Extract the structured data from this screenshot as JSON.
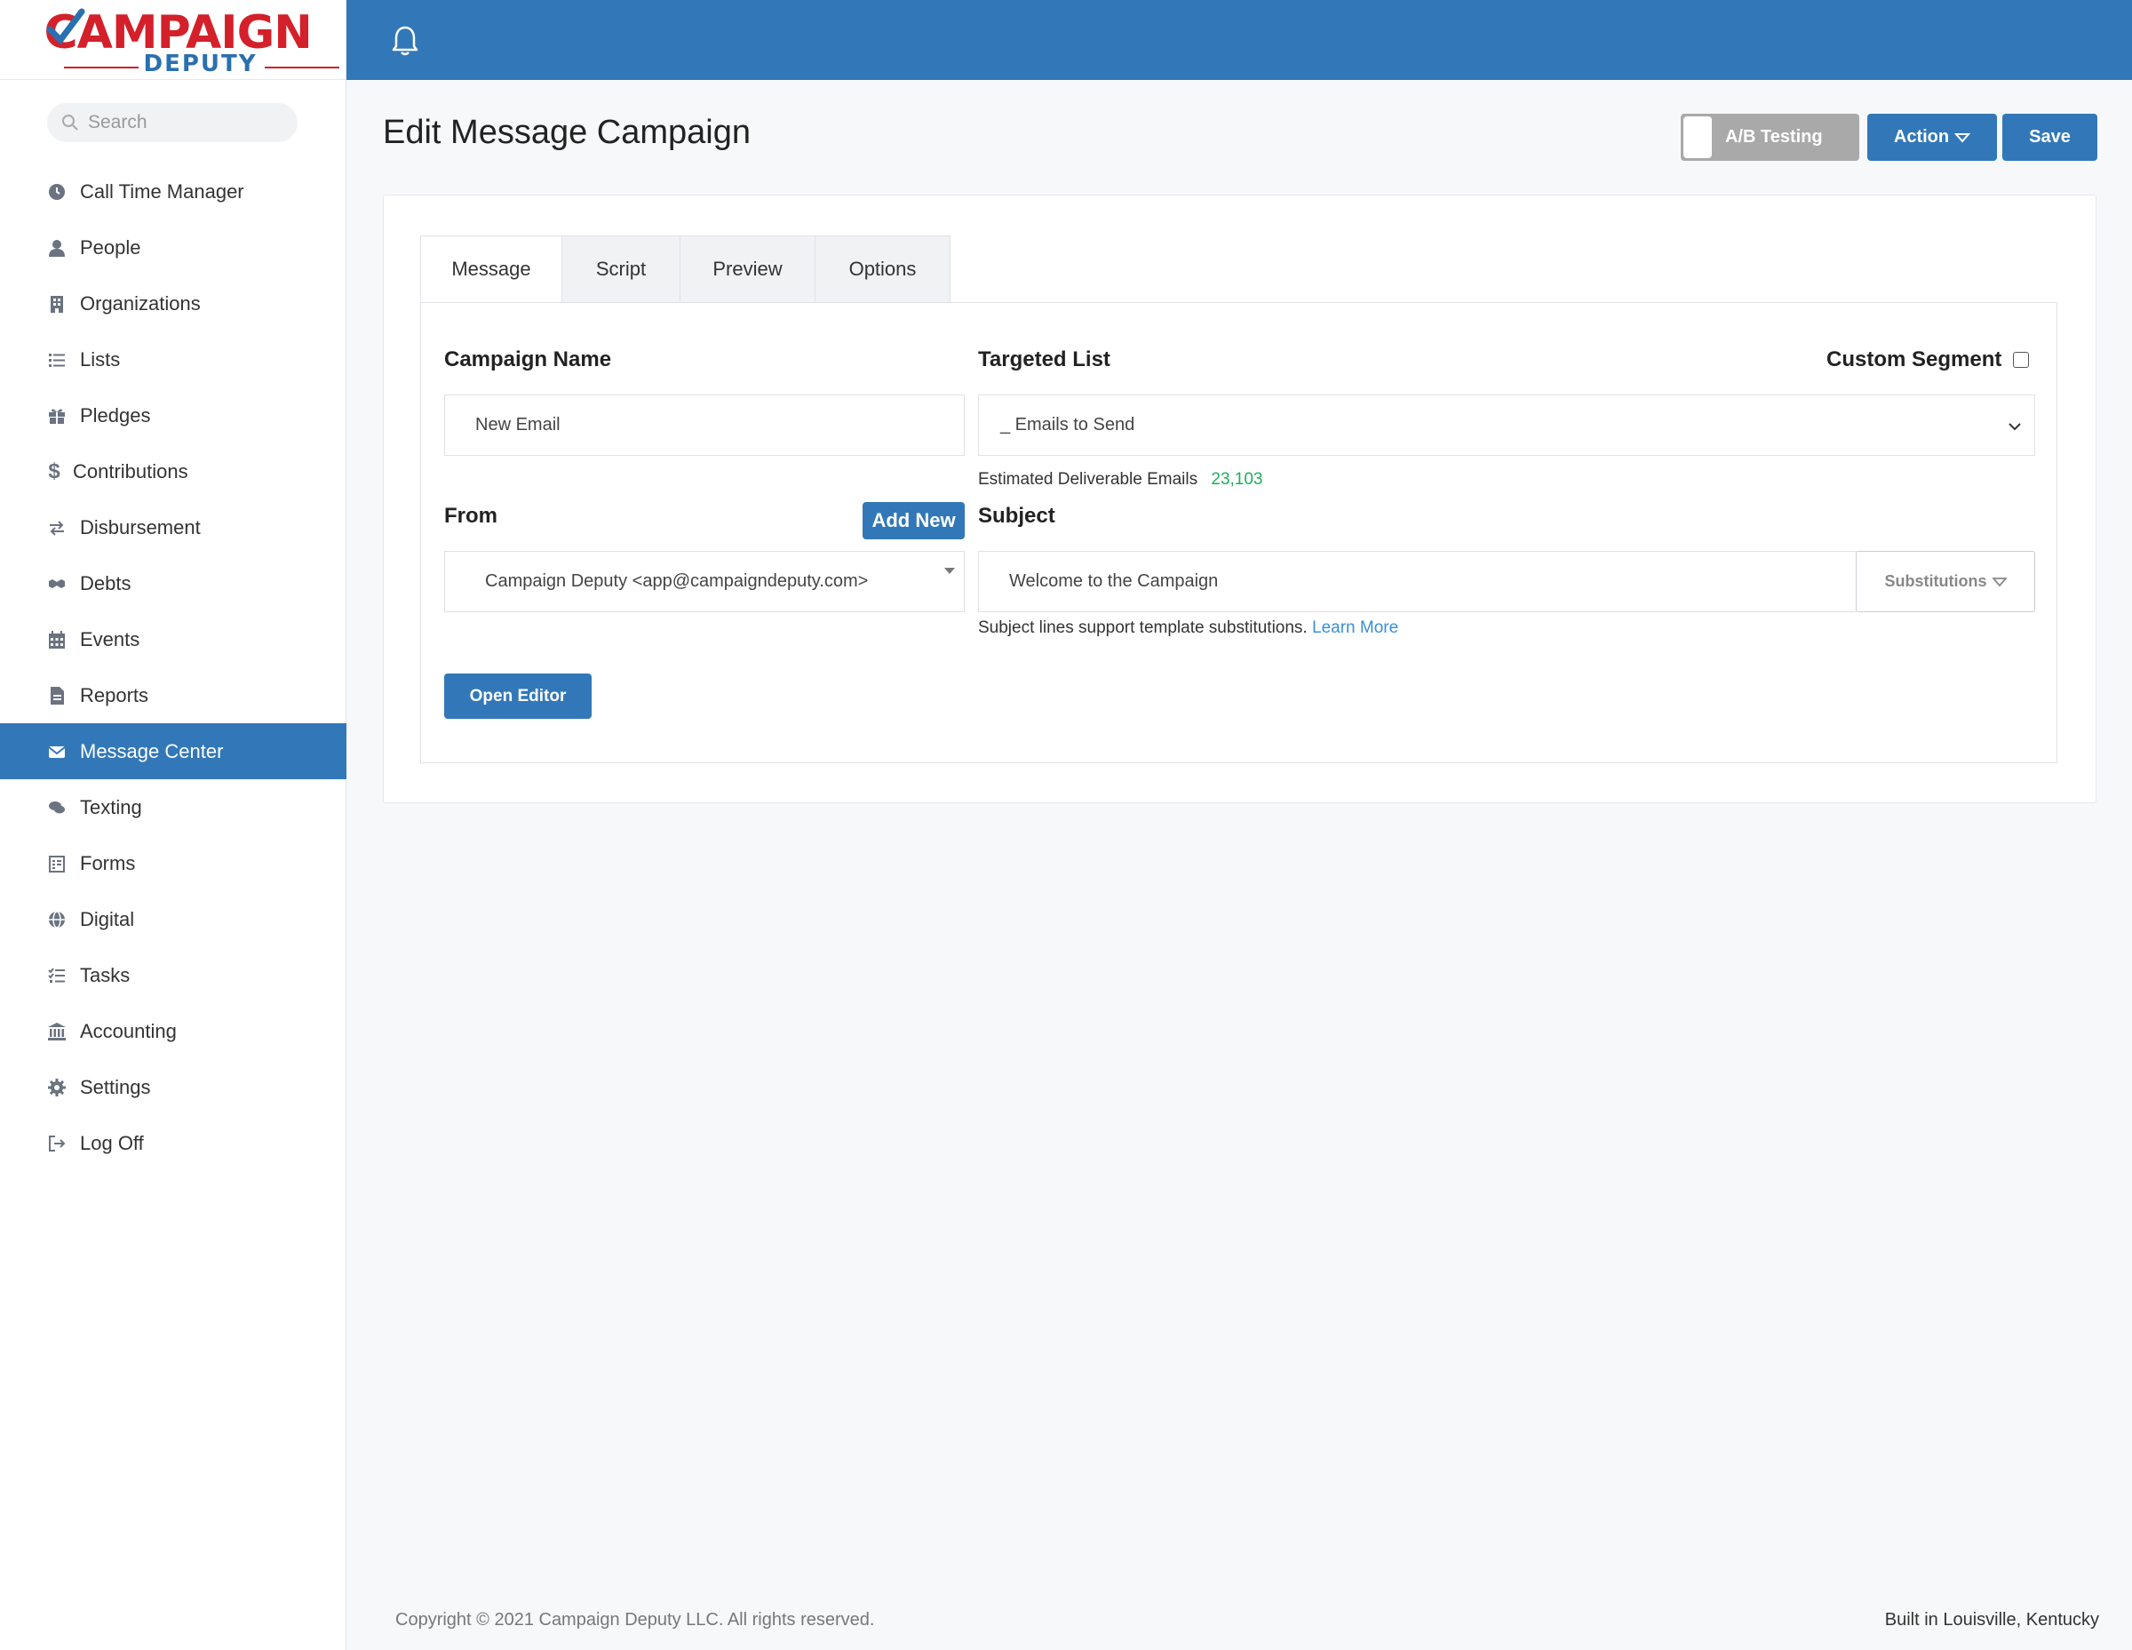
{
  "app": {
    "logo_main": "CAMPAIGN",
    "logo_sub": "DEPUTY"
  },
  "sidebar": {
    "search_placeholder": "Search",
    "items": [
      {
        "label": "Call Time Manager",
        "icon": "clock-icon"
      },
      {
        "label": "People",
        "icon": "person-icon"
      },
      {
        "label": "Organizations",
        "icon": "building-icon"
      },
      {
        "label": "Lists",
        "icon": "list-icon"
      },
      {
        "label": "Pledges",
        "icon": "gift-icon"
      },
      {
        "label": "Contributions",
        "icon": "dollar-icon"
      },
      {
        "label": "Disbursement",
        "icon": "exchange-icon"
      },
      {
        "label": "Debts",
        "icon": "handshake-icon"
      },
      {
        "label": "Events",
        "icon": "calendar-icon"
      },
      {
        "label": "Reports",
        "icon": "document-icon"
      },
      {
        "label": "Message Center",
        "icon": "envelope-icon",
        "active": true
      },
      {
        "label": "Texting",
        "icon": "chat-icon"
      },
      {
        "label": "Forms",
        "icon": "form-icon"
      },
      {
        "label": "Digital",
        "icon": "globe-icon"
      },
      {
        "label": "Tasks",
        "icon": "tasks-icon"
      },
      {
        "label": "Accounting",
        "icon": "bank-icon"
      },
      {
        "label": "Settings",
        "icon": "gear-icon"
      },
      {
        "label": "Log Off",
        "icon": "logout-icon"
      }
    ]
  },
  "header": {
    "title": "Edit Message Campaign",
    "ab_testing_label": "A/B Testing",
    "action_label": "Action",
    "save_label": "Save"
  },
  "tabs": [
    {
      "label": "Message",
      "active": true
    },
    {
      "label": "Script"
    },
    {
      "label": "Preview"
    },
    {
      "label": "Options"
    }
  ],
  "form": {
    "campaign_name_label": "Campaign Name",
    "campaign_name_value": "New Email",
    "targeted_list_label": "Targeted List",
    "targeted_list_value": "_ Emails to Send",
    "custom_segment_label": "Custom Segment",
    "estimated_label": "Estimated Deliverable Emails",
    "estimated_value": "23,103",
    "from_label": "From",
    "add_new_label": "Add New",
    "from_value": "Campaign Deputy <app@campaigndeputy.com>",
    "subject_label": "Subject",
    "subject_value": "Welcome to the Campaign",
    "substitutions_label": "Substitutions",
    "subject_help": "Subject lines support template substitutions.",
    "learn_more": "Learn More",
    "open_editor_label": "Open Editor"
  },
  "footer": {
    "copyright": "Copyright © 2021 Campaign Deputy LLC. All rights reserved.",
    "built_in": "Built in Louisville, Kentucky"
  },
  "colors": {
    "primary": "#3278b8",
    "brand_red": "#d3202a",
    "estimate_green": "#1fae5b",
    "link": "#3a8fd8"
  }
}
